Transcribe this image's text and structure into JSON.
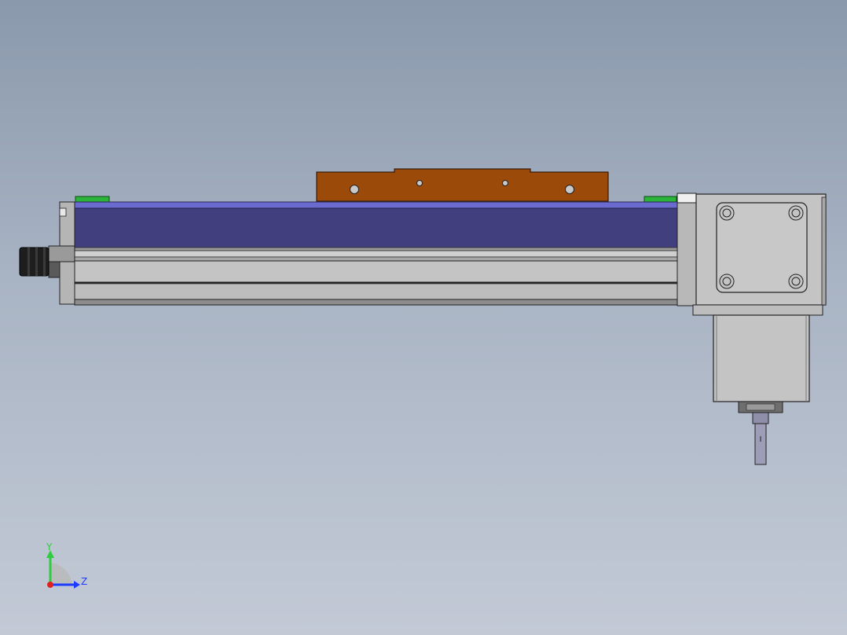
{
  "viewport": {
    "background_top": "#8a99ac",
    "background_bottom": "#c3cad6"
  },
  "model": {
    "description_icon": "linear-actuator-model",
    "colors": {
      "carriage": "#9b4a0a",
      "cover_strip": "#3f3d7c",
      "cover_top": "#6b6bcf",
      "rail_body": "#bfbfbf",
      "motor_body": "#c2c2c2",
      "end_block": "#2bb33a",
      "connector": "#222222"
    }
  },
  "triad": {
    "y_label": "Y",
    "z_label": "Z",
    "y_color": "#2ecc40",
    "z_color": "#1e3cff",
    "x_color": "#e02020"
  }
}
